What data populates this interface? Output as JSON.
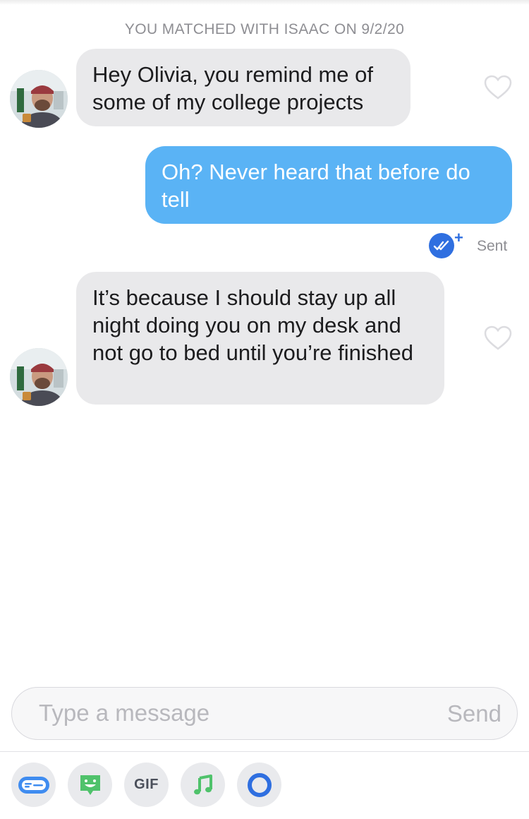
{
  "match_banner": "YOU MATCHED WITH ISAAC ON 9/2/20",
  "messages": [
    {
      "from": "Isaac",
      "text": "Hey Olivia, you remind me of some of my college projects"
    },
    {
      "from": "me",
      "text": "Oh? Never heard that before do tell"
    },
    {
      "from": "Isaac",
      "text": "It’s because I should stay up all night doing you on my desk and not go to bed until you’re finished"
    }
  ],
  "receipt": {
    "status": "Sent",
    "plus": "+"
  },
  "composer": {
    "placeholder": "Type a message",
    "send_label": "Send"
  },
  "toolbar": {
    "gif_label": "GIF",
    "icons": [
      "sticker-card-icon",
      "bitmoji-icon",
      "gif-icon",
      "music-note-icon",
      "circle-loop-icon"
    ]
  },
  "colors": {
    "outgoing_bubble": "#5ab3f5",
    "incoming_bubble": "#e9e9eb",
    "read_receipt": "#2f6fe0"
  }
}
